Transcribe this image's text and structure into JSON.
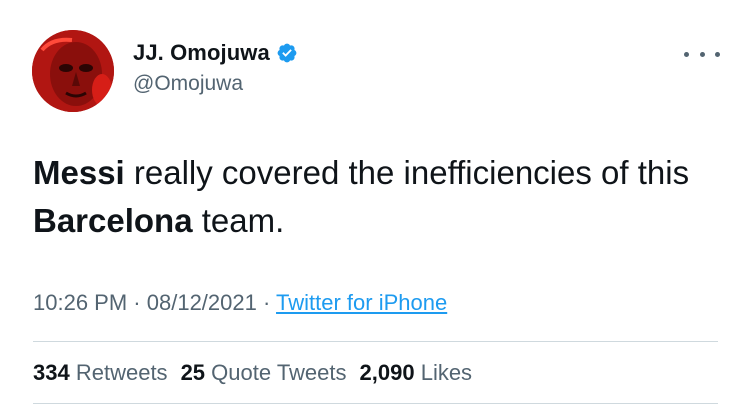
{
  "author": {
    "display_name": "JJ. Omojuwa",
    "handle": "@Omojuwa",
    "verified_icon": "verified-badge-icon",
    "avatar_color": "#b11612"
  },
  "tweet": {
    "segments": [
      {
        "text": "Messi",
        "bold": true
      },
      {
        "text": " really covered the inefficiencies of this ",
        "bold": false
      },
      {
        "text": "Barcelona",
        "bold": true
      },
      {
        "text": " team.",
        "bold": false
      }
    ]
  },
  "meta": {
    "time": "10:26 PM",
    "separator": "·",
    "date": "08/12/2021",
    "source": "Twitter for iPhone"
  },
  "stats": {
    "retweets_count": "334",
    "retweets_label": "Retweets",
    "quotes_count": "25",
    "quotes_label": "Quote Tweets",
    "likes_count": "2,090",
    "likes_label": "Likes"
  },
  "colors": {
    "primary_text": "#0f1419",
    "secondary_text": "#536471",
    "link": "#1d9bf0",
    "divider": "#cfd9de",
    "verified": "#1d9bf0"
  }
}
